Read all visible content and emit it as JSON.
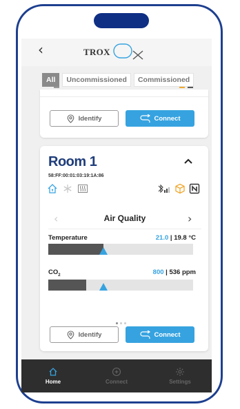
{
  "header": {
    "back": "‹",
    "logo_text": "TROX"
  },
  "filters": [
    {
      "label": "All",
      "active": true
    },
    {
      "label": "Uncommissioned",
      "active": false
    },
    {
      "label": "Commissioned",
      "active": false
    }
  ],
  "top_card": {
    "identify_label": "Identify",
    "connect_label": "Connect"
  },
  "room": {
    "title": "Room 1",
    "mac": "58:FF:00:01:03:19:1A:86",
    "section_title": "Air Quality",
    "prev": "‹",
    "next": "›",
    "temperature": {
      "label": "Temperature",
      "setpoint": "21.0",
      "separator": " | ",
      "actual": "19.8 °C",
      "fill_fraction": 0.38,
      "setpoint_fraction": 0.38
    },
    "co2": {
      "label_main": "CO",
      "label_sub": "2",
      "setpoint": "800",
      "separator": " | ",
      "actual": "536 ppm",
      "fill_fraction": 0.26,
      "setpoint_fraction": 0.38
    },
    "identify_label": "Identify",
    "connect_label": "Connect"
  },
  "tabs": [
    {
      "label": "Home",
      "icon": "home-icon",
      "active": true
    },
    {
      "label": "Connect",
      "icon": "plus-circle-icon",
      "active": false
    },
    {
      "label": "Settings",
      "icon": "gear-icon",
      "active": false
    }
  ],
  "colors": {
    "accent": "#36a3e0",
    "frame": "#1d3f8f",
    "title": "#1f3d7a",
    "tabbar": "#2e2e2e"
  }
}
